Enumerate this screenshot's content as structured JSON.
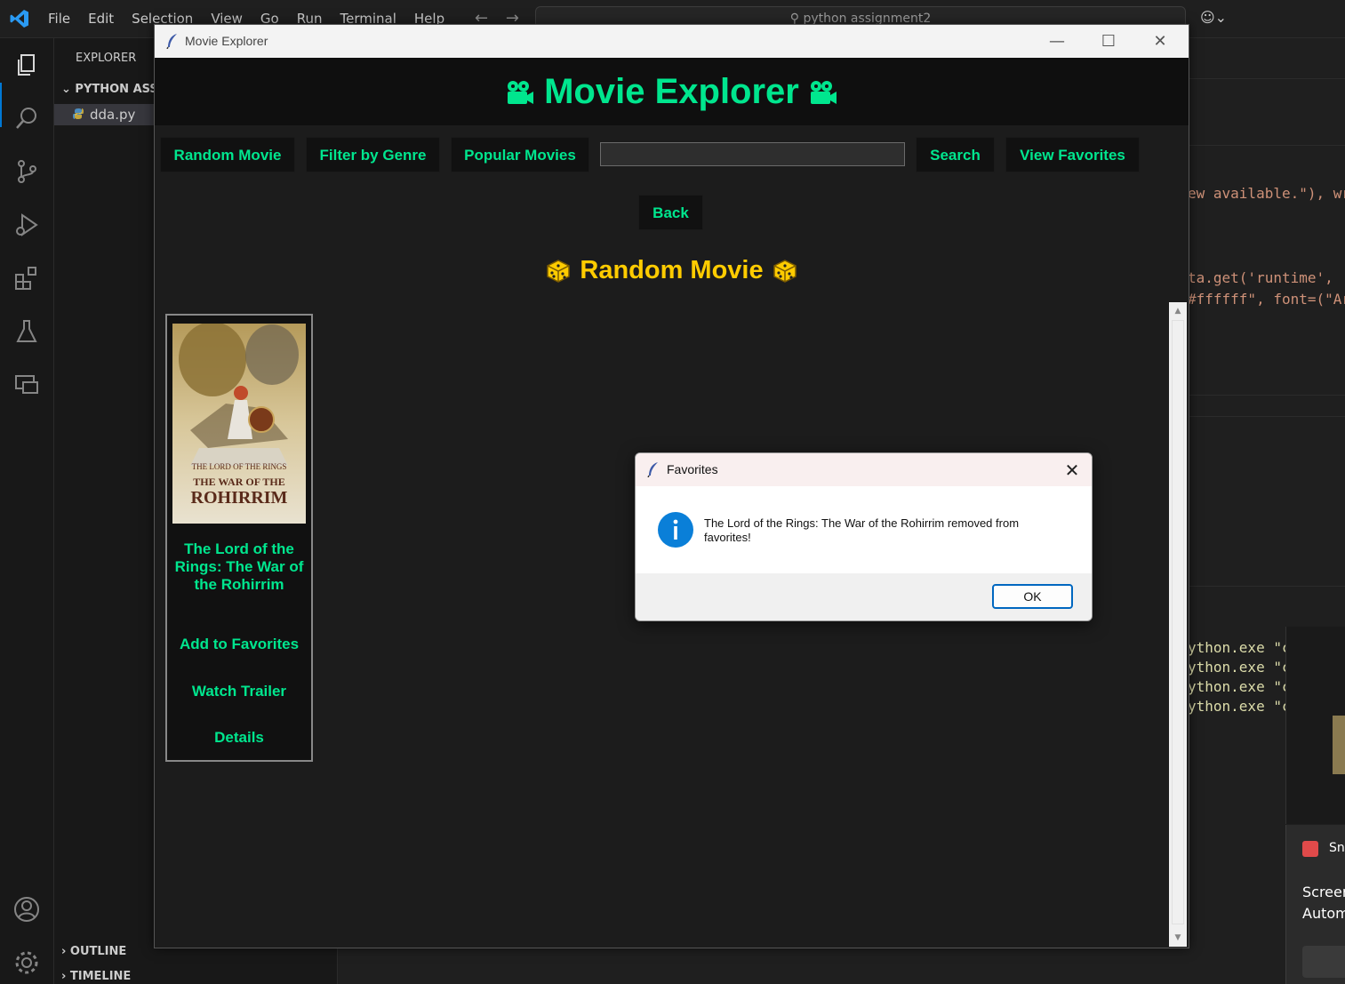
{
  "vscode": {
    "menu": [
      "File",
      "Edit",
      "Selection",
      "View",
      "Go",
      "Run",
      "Terminal",
      "Help"
    ],
    "nav_back": "←",
    "nav_forward": "→",
    "search_text": "python assignment2",
    "sidebar": {
      "title": "EXPLORER",
      "folder": "PYTHON ASSI",
      "file": "dda.py",
      "outline": "OUTLINE",
      "timeline": "TIMELINE"
    },
    "code_lines": [
      "ew available.\"), wr",
      "ta.get('runtime', '",
      "#ffffff\", font=(\"Ar",
      "ython.exe \"c:",
      "ython.exe \"c:",
      "ython.exe \"c:",
      "ython.exe \"c:"
    ],
    "toast": {
      "title": "Sn",
      "line1": "Screer",
      "line2": "Autom"
    }
  },
  "window": {
    "title": "Movie Explorer",
    "minimize": "—",
    "maximize": "☐",
    "close": "✕"
  },
  "app": {
    "title": "Movie Explorer",
    "buttons": {
      "random": "Random Movie",
      "genre": "Filter by Genre",
      "popular": "Popular Movies",
      "search": "Search",
      "favorites": "View Favorites",
      "back": "Back"
    },
    "search_value": "",
    "section_title": "Random Movie",
    "card": {
      "poster_line1": "THE LORD OF THE RINGS",
      "poster_line2": "THE WAR OF THE",
      "poster_line3": "ROHIRRIM",
      "title": "The Lord of the Rings: The War of the Rohirrim",
      "add_favorites": "Add to Favorites",
      "trailer": "Watch Trailer",
      "details": "Details"
    }
  },
  "dialog": {
    "title": "Favorites",
    "close": "✕",
    "message": "The Lord of the Rings: The War of the Rohirrim removed from favorites!",
    "ok": "OK"
  },
  "colors": {
    "accent_green": "#00e68e",
    "section_yellow": "#ffcc00",
    "info_blue": "#0a7fd8"
  }
}
